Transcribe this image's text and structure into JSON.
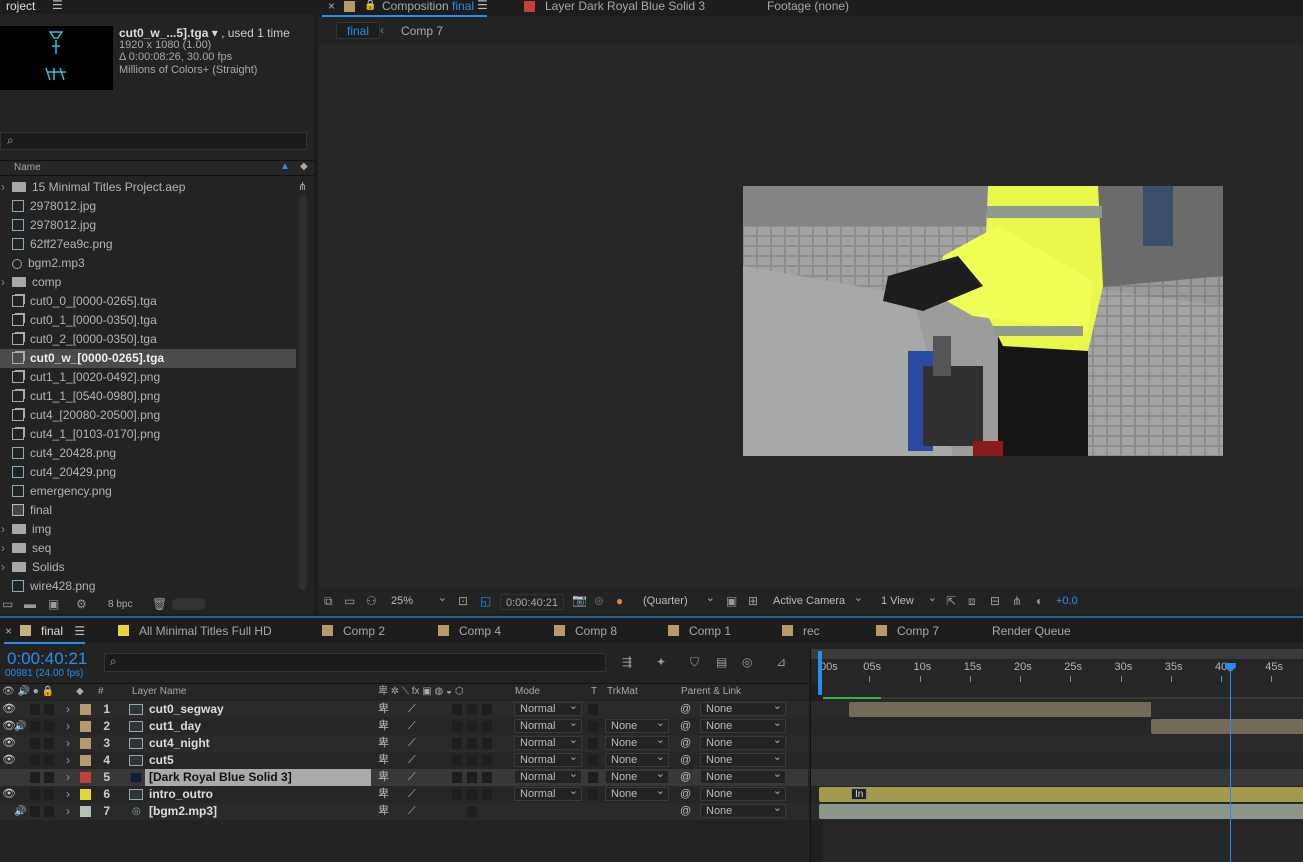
{
  "project": {
    "tab_title": "roject",
    "item_name": "cut0_w_...5].tga",
    "used": ", used 1 time",
    "resolution": "1920 x 1080 (1.00)",
    "duration": "Δ 0:00:08:26, 30.00 fps",
    "colors": "Millions of Colors+ (Straight)",
    "search_placeholder": "",
    "col_name": "Name",
    "bpc": "8 bpc",
    "items": [
      {
        "name": "15 Minimal Titles Project.aep",
        "type": "folder"
      },
      {
        "name": "2978012.jpg",
        "type": "file"
      },
      {
        "name": "2978012.jpg",
        "type": "file"
      },
      {
        "name": "62ff27ea9c.png",
        "type": "file"
      },
      {
        "name": "bgm2.mp3",
        "type": "audio"
      },
      {
        "name": "comp",
        "type": "folder"
      },
      {
        "name": "cut0_0_[0000-0265].tga",
        "type": "seq"
      },
      {
        "name": "cut0_1_[0000-0350].tga",
        "type": "seq"
      },
      {
        "name": "cut0_2_[0000-0350].tga",
        "type": "seq"
      },
      {
        "name": "cut0_w_[0000-0265].tga",
        "type": "seq",
        "selected": true
      },
      {
        "name": "cut1_1_[0020-0492].png",
        "type": "seq"
      },
      {
        "name": "cut1_1_[0540-0980].png",
        "type": "seq"
      },
      {
        "name": "cut4_[20080-20500].png",
        "type": "seq"
      },
      {
        "name": "cut4_1_[0103-0170].png",
        "type": "seq"
      },
      {
        "name": "cut4_20428.png",
        "type": "file"
      },
      {
        "name": "cut4_20429.png",
        "type": "file"
      },
      {
        "name": "emergency.png",
        "type": "file"
      },
      {
        "name": "final",
        "type": "comp"
      },
      {
        "name": "img",
        "type": "folder"
      },
      {
        "name": "seq",
        "type": "folder"
      },
      {
        "name": "Solids",
        "type": "folder"
      },
      {
        "name": "wire428.png",
        "type": "file"
      }
    ]
  },
  "viewer": {
    "tab_comp": "Composition",
    "tab_comp_name": "final",
    "tab_layer": "Layer Dark Royal Blue Solid 3",
    "tab_footage": "Footage (none)",
    "crumb_final": "final",
    "crumb_comp7": "Comp 7",
    "zoom": "25%",
    "timecode": "0:00:40:21",
    "resolution": "(Quarter)",
    "camera": "Active Camera",
    "views": "1 View",
    "exposure": "+0.0"
  },
  "timeline": {
    "tabs": [
      {
        "label": "final",
        "color": "#c9b07f",
        "active": true
      },
      {
        "label": "All Minimal Titles Full HD",
        "color": "#e5d53a"
      },
      {
        "label": "Comp 2",
        "color": "#b89a6a"
      },
      {
        "label": "Comp 4",
        "color": "#b89a6a"
      },
      {
        "label": "Comp 8",
        "color": "#b89a6a"
      },
      {
        "label": "Comp 1",
        "color": "#b89a6a"
      },
      {
        "label": "rec",
        "color": "#b89a6a"
      },
      {
        "label": "Comp 7",
        "color": "#b89a6a"
      },
      {
        "label": "Render Queue",
        "color": ""
      }
    ],
    "current_time": "0:00:40:21",
    "frame_info": "00981 (24.00 fps)",
    "col_num": "#",
    "col_layer_name": "Layer Name",
    "col_mode": "Mode",
    "col_t": "T",
    "col_trkmat": "TrkMat",
    "col_parent": "Parent & Link",
    "ticks": [
      ":00s",
      "05s",
      "10s",
      "15s",
      "20s",
      "25s",
      "30s",
      "35s",
      "40s",
      "45s"
    ],
    "playhead_seconds": 40.875,
    "layers": [
      {
        "num": "1",
        "name": "cut0_segway",
        "color": "#b89a6a",
        "mode": "Normal",
        "trkmat": "",
        "parent": "None",
        "bar_start": 3.0,
        "bar_end": 33.0,
        "bar_color": "#736a5a"
      },
      {
        "num": "2",
        "name": "cut1_day",
        "color": "#b89a6a",
        "mode": "Normal",
        "trkmat": "None",
        "parent": "None",
        "bar_start": 33.0,
        "bar_end": 50,
        "bar_color": "#736a5a"
      },
      {
        "num": "3",
        "name": "cut4_night",
        "color": "#b89a6a",
        "mode": "Normal",
        "trkmat": "None",
        "parent": "None",
        "bar_start": null,
        "bar_end": null,
        "bar_color": ""
      },
      {
        "num": "4",
        "name": "cut5",
        "color": "#b89a6a",
        "mode": "Normal",
        "trkmat": "None",
        "parent": "None",
        "bar_start": null,
        "bar_end": null,
        "bar_color": ""
      },
      {
        "num": "5",
        "name": "[Dark Royal Blue Solid 3]",
        "color": "#c24040",
        "mode": "Normal",
        "trkmat": "None",
        "parent": "None",
        "bar_start": null,
        "bar_end": null,
        "bar_color": "",
        "selected": true
      },
      {
        "num": "6",
        "name": "intro_outro",
        "color": "#e5d53a",
        "mode": "Normal",
        "trkmat": "None",
        "parent": "None",
        "bar_start": 0,
        "bar_end": 50,
        "bar_color": "#a39a4e",
        "marker": "In"
      },
      {
        "num": "7",
        "name": "[bgm2.mp3]",
        "color": "#b4c4b4",
        "mode": "",
        "trkmat": "",
        "parent": "None",
        "bar_start": 0,
        "bar_end": 50,
        "bar_color": "#8c978c"
      }
    ]
  }
}
